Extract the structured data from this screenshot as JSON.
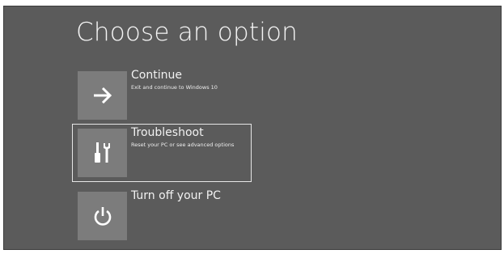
{
  "page": {
    "title": "Choose an option"
  },
  "options": [
    {
      "label": "Continue",
      "description": "Exit and continue to Windows 10",
      "icon": "arrow-right-icon",
      "selected": false
    },
    {
      "label": "Troubleshoot",
      "description": "Reset your PC or see advanced options",
      "icon": "tools-icon",
      "selected": true
    },
    {
      "label": "Turn off your PC",
      "description": "",
      "icon": "power-icon",
      "selected": false
    }
  ],
  "colors": {
    "background": "#5b5b5b",
    "tile": "#7c7c7c",
    "text": "#ffffff",
    "selection_border": "#e6e6e6"
  }
}
